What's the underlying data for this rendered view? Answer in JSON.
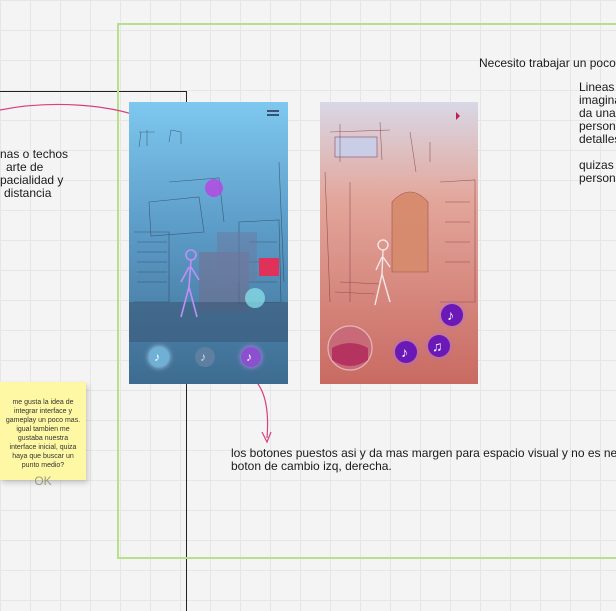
{
  "notes": {
    "top_right_heading": "Necesito trabajar un poco",
    "right_lines": [
      "Lineas",
      "imagina",
      "da una",
      "person",
      "detalles"
    ],
    "right_lines_2": [
      "quizas",
      "person"
    ],
    "left_lines": [
      "nas o techos",
      "arte de",
      "pacialidad y",
      "distancia"
    ],
    "bottom_line_1": "los botones puestos asi y da mas margen para espacio visual y no es ne",
    "bottom_line_2": "boton de cambio izq, derecha."
  },
  "sticky_note": {
    "text": "me gusta la idea de integrar interface y gameplay un poco mas. igual tambien me gustaba nuestra interface inicial, quiza haya que buscar un punto medio?",
    "ok_label": "OK"
  },
  "colors": {
    "green_frame": "#b6df8e",
    "pink_arrow": "#d6407e",
    "sticky_bg": "#fef8a4",
    "purple_button": "#6a18b6"
  },
  "icons": {
    "music_note": "♪",
    "music_notes": "♫",
    "menu": "hamburger-icon",
    "bookmark": "bookmark-icon"
  }
}
